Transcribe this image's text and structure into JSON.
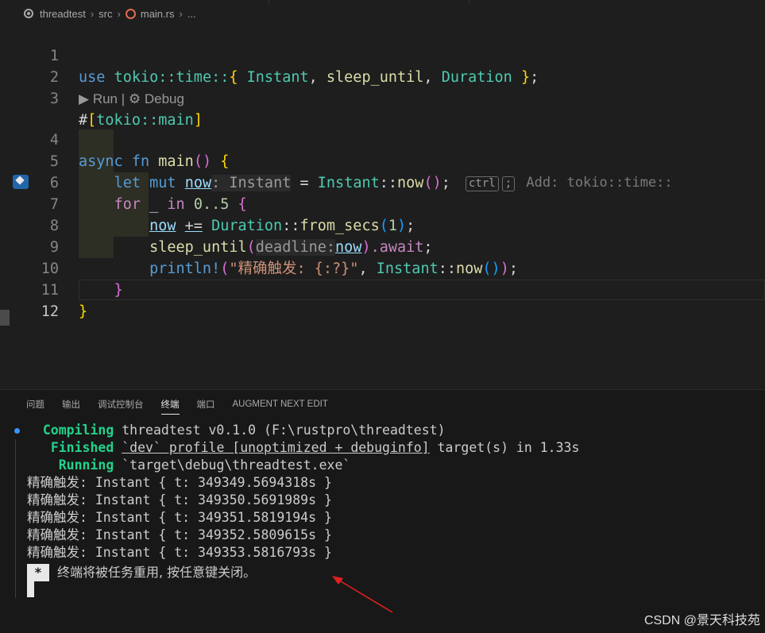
{
  "breadcrumb": {
    "project": "threadtest",
    "folder": "src",
    "file": "main.rs",
    "more": "..."
  },
  "editor": {
    "lines": [
      {
        "n": "1"
      },
      {
        "n": "2"
      },
      {
        "n": "3"
      },
      {
        "n": "4"
      },
      {
        "n": "5"
      },
      {
        "n": "6"
      },
      {
        "n": "7"
      },
      {
        "n": "8"
      },
      {
        "n": "9"
      },
      {
        "n": "10"
      },
      {
        "n": "11"
      },
      {
        "n": "12"
      }
    ],
    "codelens": {
      "run": "Run",
      "sep": "|",
      "debug": "Debug"
    },
    "ghost_hint": {
      "key1": "ctrl",
      "key2": ";",
      "text": "Add: tokio::time::"
    },
    "tokens": {
      "l1_use": "use",
      "l1_path": "tokio::time::",
      "l1_open": "{",
      "l1_instant": "Instant",
      "l1_c1": ",",
      "l1_sleep": "sleep_until",
      "l1_c2": ",",
      "l1_duration": "Duration",
      "l1_close": "}",
      "l1_semi": ";",
      "l3_hash": "#",
      "l3_open": "[",
      "l3_attr": "tokio::main",
      "l3_close": "]",
      "l4_async": "async",
      "l4_fn": "fn",
      "l4_name": "main",
      "l4_paren": "()",
      "l4_brace": "{",
      "l5_let": "let",
      "l5_mut": "mut",
      "l5_var": "now",
      "l5_hint": ": Instant",
      "l5_eq": "=",
      "l5_ty": "Instant",
      "l5_sep": "::",
      "l5_fn": "now",
      "l5_paren": "()",
      "l5_semi": ";",
      "l6_for": "for",
      "l6_us": "_",
      "l6_in": "in",
      "l6_range": "0..5",
      "l6_brace": "{",
      "l7_var": "now",
      "l7_op": "+=",
      "l7_ty": "Duration",
      "l7_sep": "::",
      "l7_fn": "from_secs",
      "l7_open": "(",
      "l7_num": "1",
      "l7_close": ")",
      "l7_semi": ";",
      "l8_fn": "sleep_until",
      "l8_open": "(",
      "l8_hint": "deadline:",
      "l8_var": "now",
      "l8_close": ")",
      "l8_await": ".await",
      "l8_semi": ";",
      "l9_fn": "println!",
      "l9_open": "(",
      "l9_str": "\"精确触发: {:?}\"",
      "l9_comma": ",",
      "l9_ty": "Instant",
      "l9_sep": "::",
      "l9_fn2": "now",
      "l9_paren": "()",
      "l9_close": ")",
      "l9_semi": ";",
      "l10_brace": "}",
      "l11_brace": "}"
    }
  },
  "panel": {
    "tabs": [
      {
        "label": "问题"
      },
      {
        "label": "输出"
      },
      {
        "label": "调试控制台"
      },
      {
        "label": "终端"
      },
      {
        "label": "端口"
      },
      {
        "label": "AUGMENT NEXT EDIT"
      }
    ],
    "terminal": {
      "compiling_label": "Compiling",
      "compiling_text": "threadtest v0.1.0 (F:\\rustpro\\threadtest)",
      "finished_label": "Finished",
      "finished_profile": "`dev` profile [unoptimized + debuginfo]",
      "finished_rest": "target(s) in 1.33s",
      "running_label": "Running",
      "running_text": "`target\\debug\\threadtest.exe`",
      "outputs": [
        "精确触发: Instant { t: 349349.5694318s }",
        "精确触发: Instant { t: 349350.5691989s }",
        "精确触发: Instant { t: 349351.5819194s }",
        "精确触发: Instant { t: 349352.5809615s }",
        "精确触发: Instant { t: 349353.5816793s }"
      ],
      "star": "*",
      "close_message": "终端将被任务重用, 按任意键关闭。"
    }
  },
  "watermark": "CSDN @景天科技苑",
  "colors": {
    "keyword": "#569cd6",
    "type": "#4ec9b0",
    "function": "#dcdcaa",
    "variable": "#9cdcfe",
    "string": "#ce9178",
    "success": "#23d18b",
    "annotation_arrow": "#e02020"
  }
}
